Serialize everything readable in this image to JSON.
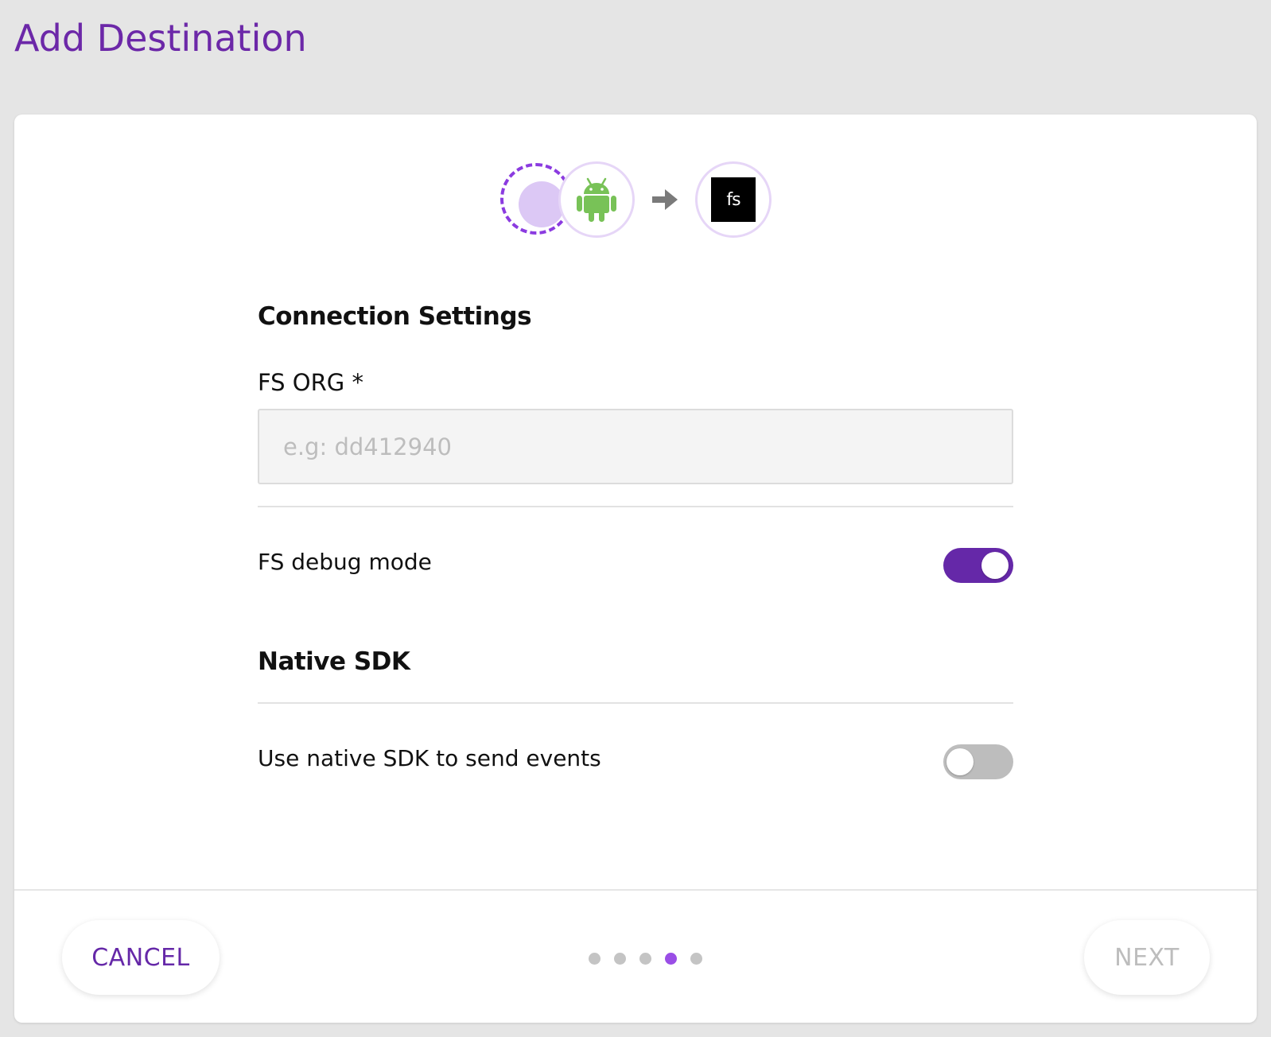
{
  "page": {
    "title": "Add Destination"
  },
  "flow": {
    "source_icon": "source-placeholder-icon",
    "platform_icon": "android-icon",
    "arrow_icon": "arrow-right-icon",
    "destination_icon": "fs-logo-icon",
    "destination_logo_text": "fs"
  },
  "connection_settings": {
    "title": "Connection Settings",
    "fs_org": {
      "label": "FS ORG *",
      "value": "",
      "placeholder": "e.g: dd412940"
    },
    "fs_debug_mode": {
      "label": "FS debug mode",
      "enabled": true
    }
  },
  "native_sdk": {
    "title": "Native SDK",
    "use_native_sdk": {
      "label": "Use native SDK to send events",
      "enabled": false
    }
  },
  "footer": {
    "cancel_label": "CANCEL",
    "next_label": "NEXT",
    "steps_total": 5,
    "current_step": 4
  },
  "colors": {
    "accent": "#6528a8",
    "title": "#6c28a8",
    "active_dot": "#9a4ee6",
    "android_green": "#78c257"
  }
}
